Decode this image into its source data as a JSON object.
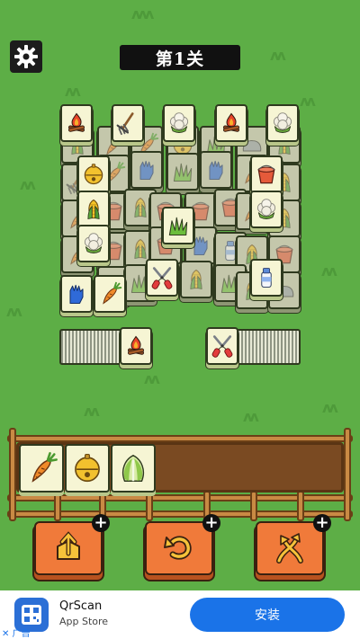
{
  "level": {
    "title": "第1关"
  },
  "colors": {
    "background": "#5dae46",
    "tile_face": "#f6f5d4",
    "tool_button": "#f07a3a",
    "install_button": "#1a73e8"
  },
  "board": {
    "top_tiles": [
      "campfire",
      "rake",
      "cauliflower",
      "campfire",
      "cauliflower"
    ],
    "left_column": [
      "bell",
      "corn",
      "cauliflower"
    ],
    "center_tiles": [
      "grass",
      "pruning-shears"
    ],
    "right_column": [
      "bucket",
      "cauliflower",
      "milk-bottle"
    ],
    "under_layer": [
      "glove",
      "carrot"
    ],
    "left_stack_top": "campfire",
    "right_stack_top": "pruning-shears"
  },
  "tray": {
    "slots": [
      "carrot",
      "bell",
      "napa-cabbage"
    ]
  },
  "tools": [
    {
      "name": "move-out",
      "icon": "box-arrow-up-icon",
      "badge": "+"
    },
    {
      "name": "undo",
      "icon": "undo-arrow-icon",
      "badge": "+"
    },
    {
      "name": "shuffle",
      "icon": "shuffle-arrows-icon",
      "badge": "+"
    }
  ],
  "ad": {
    "app_name": "QrScan",
    "store": "App Store",
    "install_label": "安装",
    "ad_label": "广告",
    "close_mark": "✕"
  }
}
